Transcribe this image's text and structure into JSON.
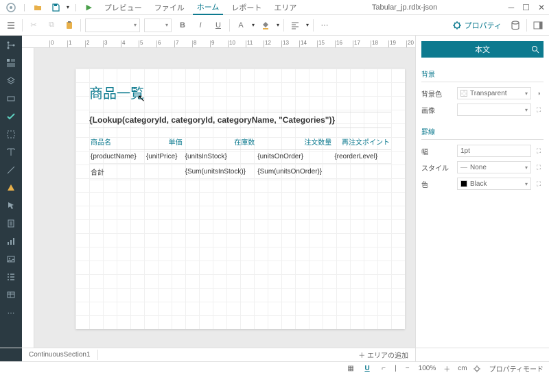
{
  "titlebar": {
    "preview": "プレビュー",
    "file": "ファイル",
    "home": "ホーム",
    "report": "レポート",
    "area": "エリア",
    "doc_title": "Tabular_jp.rdlx-json"
  },
  "toolbar": {
    "properties": "プロパティ"
  },
  "report": {
    "title": "商品一覧",
    "lookup": "{Lookup(categoryId, categoryId, categoryName, \"Categories\")}",
    "col1": "商品名",
    "col2": "単価",
    "col3": "在庫数",
    "col4": "注文数量",
    "col5": "再注文ポイント",
    "val1": "{productName}",
    "val2": "{unitPrice}",
    "val3": "{unitsInStock}",
    "val4": "{unitsOnOrder}",
    "val5": "{reorderLevel}",
    "total": "合計",
    "sum3": "{Sum(unitsInStock)}",
    "sum4": "{Sum(unitsOnOrder)}"
  },
  "props": {
    "header": "本文",
    "bg_section": "背景",
    "bg_color_label": "背景色",
    "bg_color_value": "Transparent",
    "image_label": "画像",
    "border_section": "罫線",
    "width_label": "幅",
    "width_value": "1pt",
    "style_label": "スタイル",
    "style_value": "None",
    "color_label": "色",
    "color_value": "Black"
  },
  "sections": {
    "tab1": "ContinuousSection1",
    "add": "エリアの追加"
  },
  "status": {
    "zoom": "100%",
    "unit": "cm",
    "prop_mode": "プロパティモード"
  }
}
